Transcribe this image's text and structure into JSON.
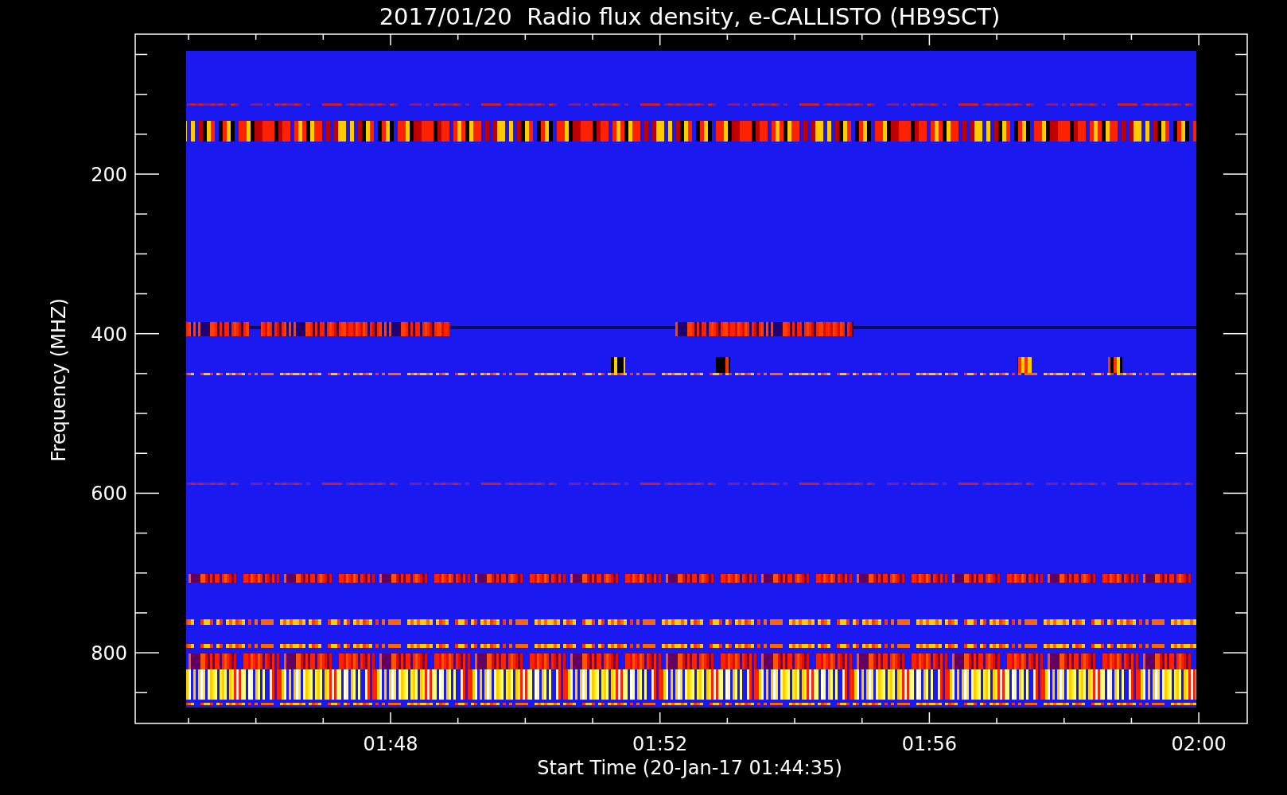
{
  "plot": {
    "title": "2017/01/20  Radio flux density, e-CALLISTO (HB9SCT)",
    "xlabel": "Start Time (20-Jan-17 01:44:35)",
    "ylabel": "Frequency (MHZ)",
    "xticks": [
      "01:48",
      "01:52",
      "01:56",
      "02:00"
    ],
    "yticks": [
      "200",
      "400",
      "600",
      "800"
    ]
  }
}
